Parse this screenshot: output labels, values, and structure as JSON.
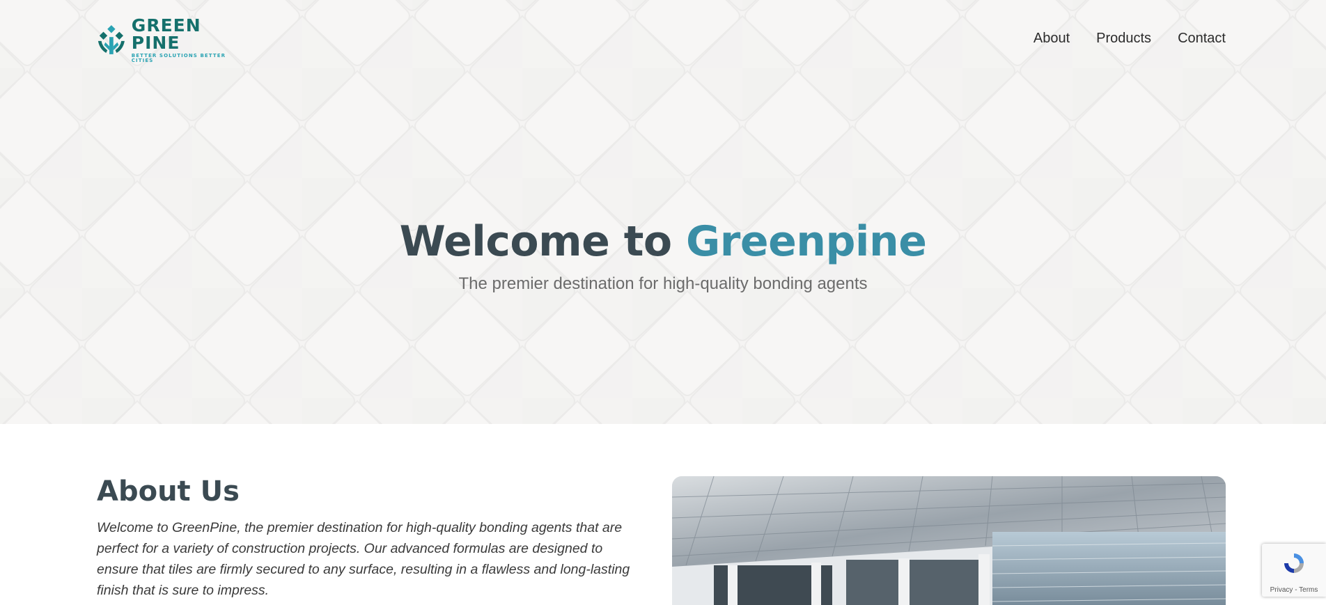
{
  "header": {
    "logo": {
      "name": "GREEN PINE",
      "tagline": "BETTER SOLUTIONS BETTER CITIES"
    },
    "nav": [
      {
        "label": "About"
      },
      {
        "label": "Products"
      },
      {
        "label": "Contact"
      }
    ]
  },
  "hero": {
    "title_prefix": "Welcome to ",
    "title_accent": "Greenpine",
    "subtitle": "The premier destination for high-quality bonding agents"
  },
  "about": {
    "heading": "About Us",
    "text": "Welcome to GreenPine, the premier destination for high-quality bonding agents that are perfect for a variety of construction projects. Our advanced formulas are designed to ensure that tiles are firmly secured to any surface, resulting in a flawless and long-lasting finish that is sure to impress."
  },
  "recaptcha": {
    "links": "Privacy - Terms"
  },
  "colors": {
    "brand_dark": "#15706c",
    "brand_light": "#2aa3b3",
    "accent": "#3a8ea6",
    "heading": "#3b4a52"
  }
}
